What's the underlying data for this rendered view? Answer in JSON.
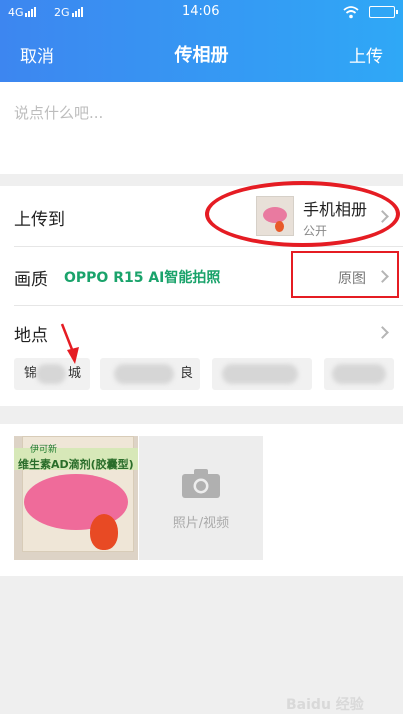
{
  "status_bar": {
    "network_1": "4G",
    "network_2": "2G",
    "time": "14:06"
  },
  "nav": {
    "cancel_label": "取消",
    "title": "传相册",
    "upload_label": "上传"
  },
  "compose": {
    "placeholder": "说点什么吧..."
  },
  "upload_to": {
    "label": "上传到",
    "album_name": "手机相册",
    "album_visibility": "公开"
  },
  "quality": {
    "label": "画质",
    "device_info": "OPPO R15  AI智能拍照",
    "value": "原图"
  },
  "location": {
    "label": "地点",
    "chips": [
      "锦",
      "城",
      "",
      "良",
      "",
      ""
    ]
  },
  "media": {
    "photo_text_small": "伊可新",
    "photo_text_large": "维生素AD滴剂(胶囊型)",
    "add_label": "照片/视频"
  },
  "watermark": "Baidu 经验",
  "colors": {
    "header_start": "#3d86f0",
    "header_end": "#2fa8f6",
    "accent_green": "#1aa36b",
    "annotation_red": "#e51c23"
  }
}
